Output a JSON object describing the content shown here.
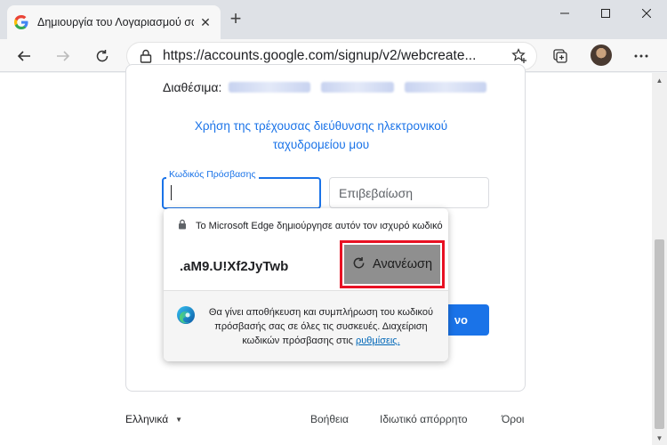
{
  "tab": {
    "title": "Δημιουργία του Λογαριασμού σας",
    "close": "✕",
    "new_tab": "+"
  },
  "window": {
    "minimize": "—",
    "maximize": "☐",
    "close": "✕"
  },
  "toolbar": {
    "url": "https://accounts.google.com/signup/v2/webcreate..."
  },
  "form": {
    "available_label": "Διαθέσιμα:",
    "use_current_link": "Χρήση της τρέχουσας διεύθυνσης ηλεκτρονικού ταχυδρομείου μου",
    "password_label": "Κωδικός Πρόσβασης",
    "confirm_placeholder": "Επιβεβαίωση",
    "next_button": "νο"
  },
  "popup": {
    "header": "Το Microsoft Edge δημιούργησε αυτόν τον ισχυρό κωδικό",
    "suggested_password": ".aM9.U!Xf2JyTwb",
    "refresh_button": "Ανανέωση",
    "footer_text": "Θα γίνει αποθήκευση και συμπλήρωση του κωδικού πρόσβασής σας σε όλες τις συσκευές. Διαχείριση κωδικών πρόσβασης στις",
    "footer_link": "ρυθμίσεις."
  },
  "footer": {
    "language": "Ελληνικά",
    "help": "Βοήθεια",
    "privacy": "Ιδιωτικό απόρρητο",
    "terms": "Όροι"
  },
  "colors": {
    "accent": "#1a73e8",
    "highlight_border": "#e81123"
  }
}
